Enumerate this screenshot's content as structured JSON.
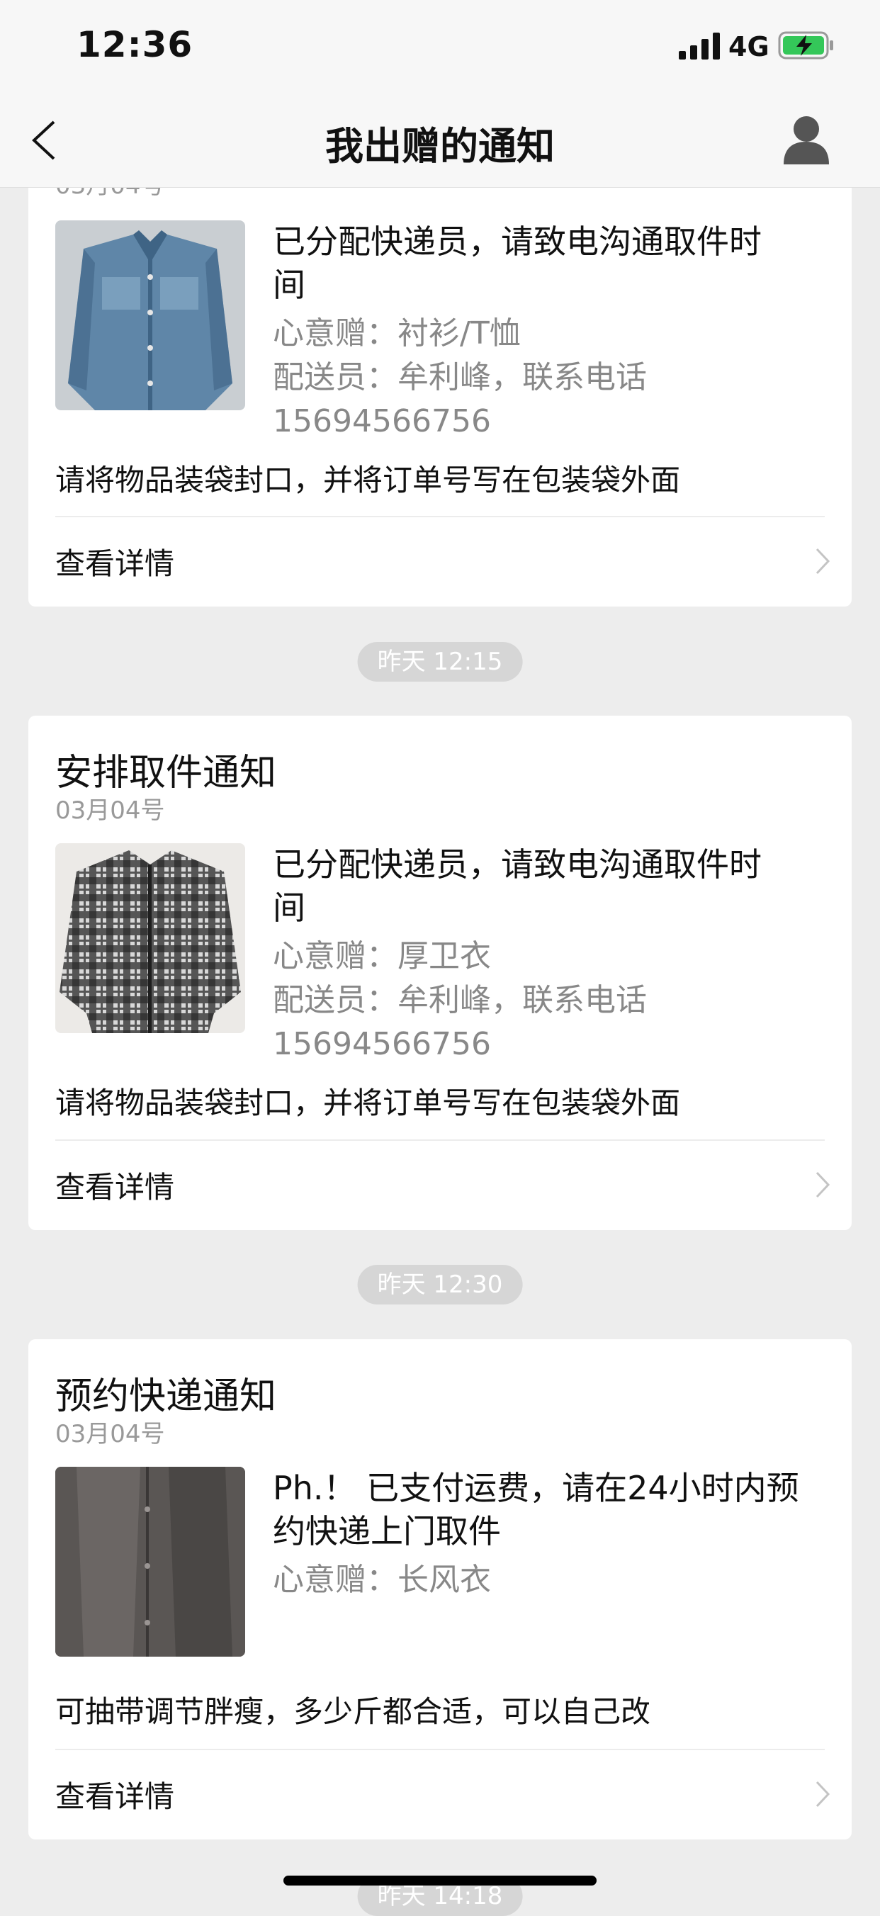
{
  "status_bar": {
    "time": "12:36",
    "network": "4G"
  },
  "nav": {
    "title": "我出赠的通知"
  },
  "cards": [
    {
      "date": "03月04号",
      "message_line1": "已分配快递员，请致电沟通取件时",
      "message_line2": "间",
      "gift": "心意赠：衬衫/T恤",
      "courier": "配送员：牟利峰，联系电话",
      "phone": "15694566756",
      "note": "请将物品装袋封口，并将订单号写在包装袋外面",
      "detail_label": "查看详情",
      "thumb_colors": {
        "base": "#5f86a8",
        "light": "#86a9c6",
        "dark": "#3f6485"
      }
    },
    {
      "timestamp": "昨天 12:15",
      "title": "安排取件通知",
      "date": "03月04号",
      "message_line1": "已分配快递员，请致电沟通取件时",
      "message_line2": "间",
      "gift": "心意赠：厚卫衣",
      "courier": "配送员：牟利峰，联系电话",
      "phone": "15694566756",
      "note": "请将物品装袋封口，并将订单号写在包装袋外面",
      "detail_label": "查看详情",
      "thumb_colors": {
        "base": "#e8e8e8",
        "light": "#ffffff",
        "dark": "#1e1e1e"
      }
    },
    {
      "timestamp": "昨天 12:30",
      "title": "预约快递通知",
      "date": "03月04号",
      "message_line1": "Ph.！ 已支付运费，请在24小时内预",
      "message_line2": "约快递上门取件",
      "gift": "心意赠：长风衣",
      "note": "可抽带调节胖瘦，多少斤都合适，可以自己改",
      "detail_label": "查看详情",
      "thumb_colors": {
        "base": "#5a5654",
        "light": "#777270",
        "dark": "#3a3736"
      }
    }
  ],
  "bottom_timestamp": "昨天 14:18"
}
